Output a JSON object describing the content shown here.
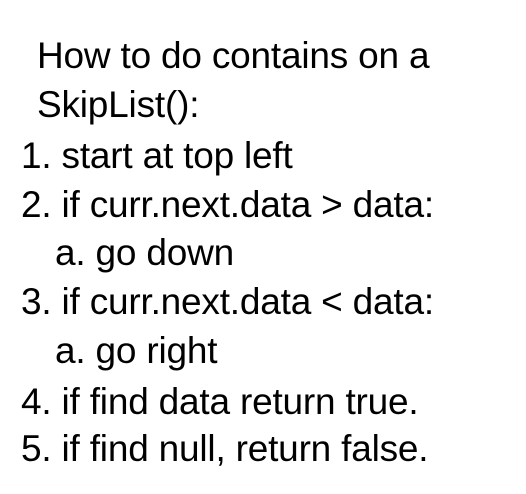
{
  "heading": {
    "line1": "How to do contains on a",
    "line2": "SkipList():"
  },
  "steps": [
    "1. start at top left",
    "2. if curr.next.data > data:",
    "a. go down",
    "3. if curr.next.data < data:",
    "a. go right",
    "4. if find data return true.",
    "5. if find null, return false."
  ]
}
